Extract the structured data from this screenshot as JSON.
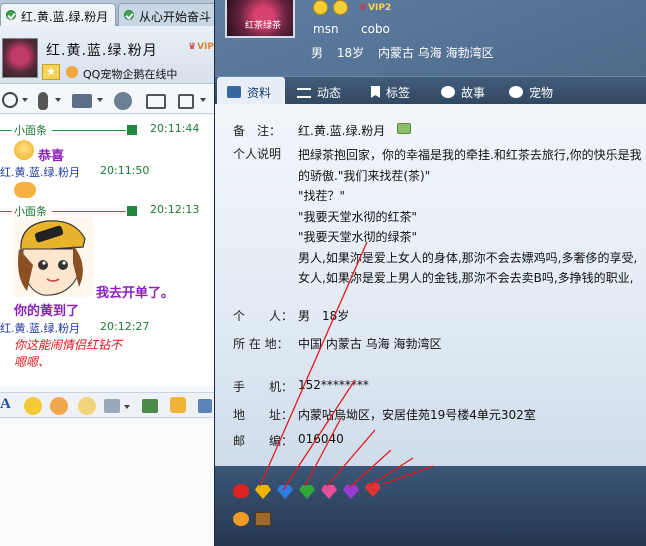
{
  "left": {
    "tabs": [
      {
        "label": "红.黄.蓝.绿.粉月"
      },
      {
        "label": "从心开始奋斗"
      }
    ],
    "contact_name": "红.黄.蓝.绿.粉月",
    "vip_badge": "VIP",
    "status_text": "QQ宠物企鹅在线中",
    "messages": {
      "header1_name": "小面条",
      "header1_time": "20:11:44",
      "gongxi": "恭喜",
      "sender1": "红.黄.蓝.绿.粉月",
      "sender1_time": "20:11:50",
      "header2_name": "小面条",
      "header2_time": "20:12:13",
      "kaidan": "我去开单了。",
      "huang": "你的黄到了",
      "sender2": "红.黄.蓝.绿.粉月",
      "sender2_time": "20:12:27",
      "red1": "你这能闹情侣红钻不",
      "red2": "嗯嗯、"
    },
    "toolbar_icons": [
      "video-icon",
      "mic-icon",
      "transfer-icon",
      "add-contact-icon",
      "screen-icon",
      "more-icon"
    ],
    "input_toolbar_icons": [
      "font-icon",
      "smile-icon",
      "magic-face-icon",
      "emoji-icon",
      "screenshot-icon",
      "image-icon",
      "music-icon",
      "desktop-icon"
    ]
  },
  "profile": {
    "avatar_label": "红茶绿茶",
    "vip_badge": "VIP2",
    "msn": "msn",
    "cobo": "cobo",
    "gender": "男",
    "age": "18岁",
    "region": "内蒙古 乌海 海勃湾区",
    "tabs": [
      {
        "label": "资料",
        "icon": "profile-card-icon"
      },
      {
        "label": "动态",
        "icon": "feed-icon"
      },
      {
        "label": "标签",
        "icon": "tag-icon"
      },
      {
        "label": "故事",
        "icon": "story-icon"
      },
      {
        "label": "宠物",
        "icon": "pet-icon"
      }
    ],
    "fields": {
      "note_label": "备　注：",
      "note_value": "红.黄.蓝.绿.粉月",
      "bio_label": "个人说明",
      "bio_lines": [
        "把绿茶抱回家，你的幸福是我的牵挂.和红茶去旅行,你的快乐是我",
        "的骄傲.\"我们来找茬(茶)\"",
        "\"找茬？\"",
        "\"我要天堂水彻的红茶\"",
        "\"我要天堂水彻的绿茶\"",
        "男人,如果沵是爱上女人的身体,那沵不会去嫖鸡吗,多奢侈的享受,",
        "女人,如果沵是爱上男人的金钱,那沵不会去卖B吗,多挣钱的职业,"
      ],
      "person_label": "个　　人：",
      "person_value": "男　18岁",
      "location_label": "所 在 地：",
      "location_value": "中国 内蒙古 乌海 海勃湾区",
      "phone_label": "手　　机：",
      "phone_value": "152********",
      "address_label": "地　　址：",
      "address_value": "内蒙呫烏坳区，安居佳苑19号楼4单元302室",
      "zip_label": "邮　　编：",
      "zip_value": "016040"
    },
    "service_icons": [
      {
        "name": "qq-penguin-icon",
        "color": "#d22"
      },
      {
        "name": "yellow-diamond-icon",
        "color": "#f0b400"
      },
      {
        "name": "blue-diamond-icon",
        "color": "#2a7fe0"
      },
      {
        "name": "green-diamond-icon",
        "color": "#2fa83a"
      },
      {
        "name": "pink-diamond-icon",
        "color": "#e64d9a"
      },
      {
        "name": "purple-diamond-icon",
        "color": "#9a3ad6"
      },
      {
        "name": "red-diamond-icon",
        "color": "#e23232"
      },
      {
        "name": "qq-pet-icon",
        "color": "#f19a28"
      },
      {
        "name": "gift-box-icon",
        "color": "#9b6a2c"
      }
    ]
  }
}
